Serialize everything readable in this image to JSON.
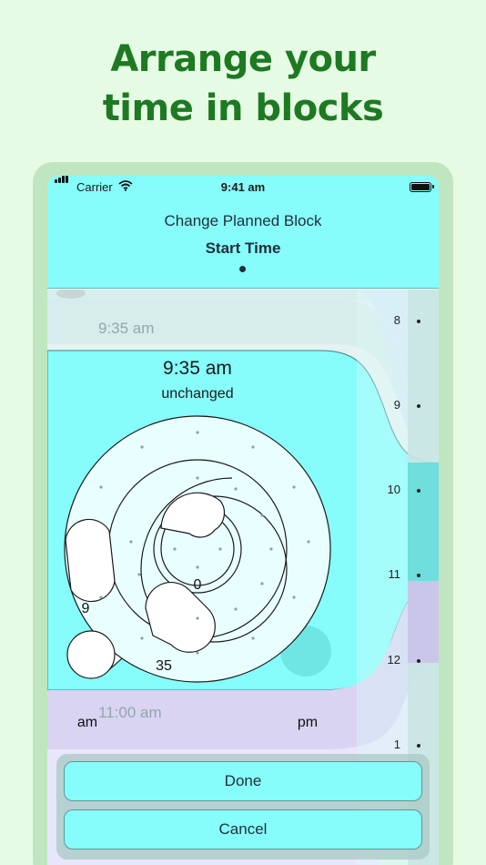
{
  "headline": {
    "line1": "Arrange your",
    "line2": "time in blocks"
  },
  "status_bar": {
    "carrier": "Carrier",
    "time": "9:41 am"
  },
  "header": {
    "title": "Change Planned Block",
    "subtitle": "Start Time"
  },
  "timeline": {
    "previous_block_time": "9:35 am",
    "next_block_time": "11:00 am",
    "hour_marks": [
      "8",
      "9",
      "10",
      "11",
      "12",
      "1"
    ]
  },
  "picker": {
    "selected_time": "9:35 am",
    "status": "unchanged",
    "center_value": "0",
    "hour_value": "9",
    "minute_value": "35",
    "am_label": "am",
    "pm_label": "pm"
  },
  "actions": {
    "done_label": "Done",
    "cancel_label": "Cancel"
  }
}
